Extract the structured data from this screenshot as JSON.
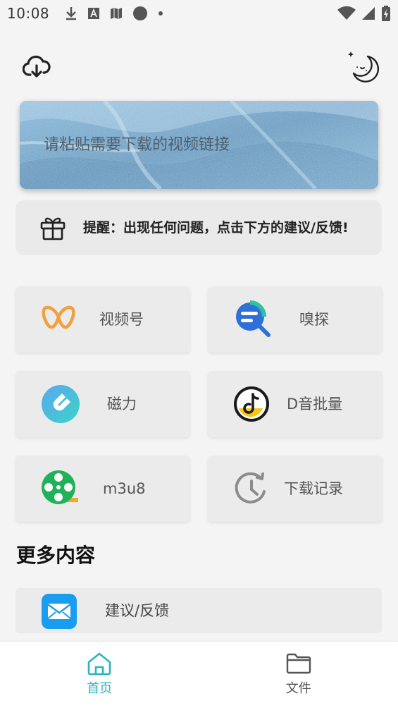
{
  "status_bar": {
    "time": "10:08",
    "icons": [
      "download-icon",
      "a-icon",
      "map-icon",
      "circle-icon",
      "dot-icon",
      "wifi-icon",
      "signal-icon",
      "battery-icon"
    ]
  },
  "header": {
    "left_icon": "cloud-download-icon",
    "right_icon": "night-mode-icon"
  },
  "url_input": {
    "placeholder": "请粘贴需要下载的视频链接"
  },
  "notice": {
    "icon": "gift-icon",
    "text": "提醒：出现任何问题，点击下方的建议/反馈!"
  },
  "tools": [
    {
      "label": "视频号",
      "icon": "butterfly-icon"
    },
    {
      "label": "嗅探",
      "icon": "sniff-search-icon"
    },
    {
      "label": "磁力",
      "icon": "magnet-icon"
    },
    {
      "label": "D音批量",
      "icon": "music-note-icon"
    },
    {
      "label": "m3u8",
      "icon": "film-reel-icon"
    },
    {
      "label": "下载记录",
      "icon": "history-clock-icon"
    }
  ],
  "more_section": {
    "title": "更多内容",
    "items": [
      {
        "label": "建议/反馈",
        "icon": "mail-icon"
      }
    ]
  },
  "bottom_nav": [
    {
      "label": "首页",
      "icon": "home-icon",
      "active": true
    },
    {
      "label": "文件",
      "icon": "folder-icon",
      "active": false
    }
  ],
  "colors": {
    "accent": "#2bb3c0",
    "background": "#f4f4f4",
    "tile": "#ebebeb"
  }
}
